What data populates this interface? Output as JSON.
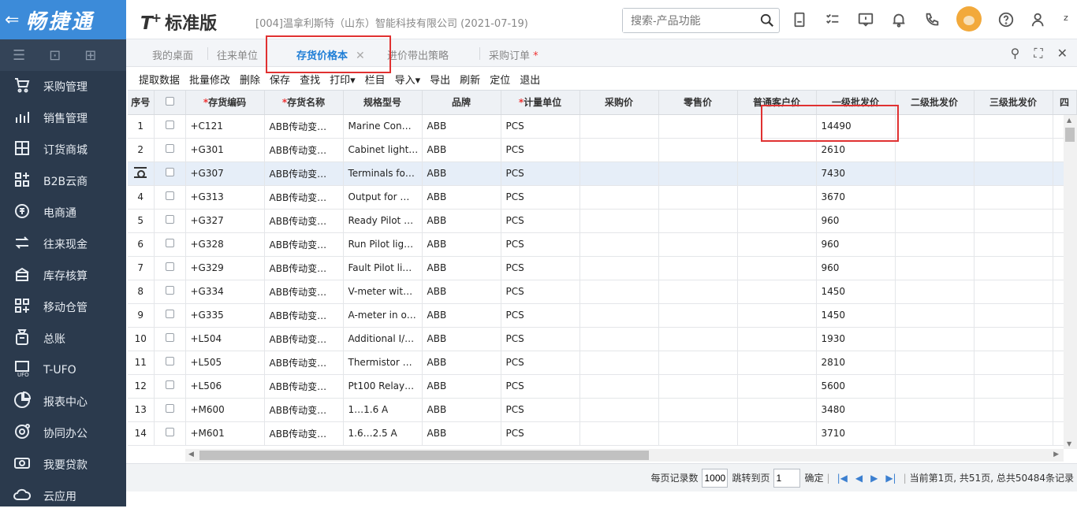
{
  "sidebar": {
    "brand": "畅捷通",
    "items": [
      {
        "label": "采购管理",
        "icon": "cart-icon"
      },
      {
        "label": "销售管理",
        "icon": "chart-icon"
      },
      {
        "label": "订货商城",
        "icon": "store-icon"
      },
      {
        "label": "B2B云商",
        "icon": "grid-plus-icon"
      },
      {
        "label": "电商通",
        "icon": "ecommerce-icon"
      },
      {
        "label": "往来现金",
        "icon": "exchange-icon"
      },
      {
        "label": "库存核算",
        "icon": "inventory-icon"
      },
      {
        "label": "移动仓管",
        "icon": "mobile-warehouse-icon"
      },
      {
        "label": "总账",
        "icon": "ledger-icon"
      },
      {
        "label": "T-UFO",
        "icon": "ufo-icon"
      },
      {
        "label": "报表中心",
        "icon": "pie-icon"
      },
      {
        "label": "协同办公",
        "icon": "collab-icon"
      },
      {
        "label": "我要贷款",
        "icon": "loan-icon"
      },
      {
        "label": "云应用",
        "icon": "cloud-icon"
      }
    ]
  },
  "header": {
    "logo": "T",
    "logo_plus": "+",
    "edition": "标准版",
    "company": "[004]温拿利斯特（山东）智能科技有限公司   (2021-07-19)",
    "search_placeholder": "搜索-产品功能",
    "user": "z"
  },
  "tabs": [
    {
      "label": "我的桌面"
    },
    {
      "label": "往来单位"
    },
    {
      "label": "存货价格本",
      "close": "✕"
    },
    {
      "label": "进价带出策略"
    },
    {
      "label": "采购订单",
      "mark": "*"
    }
  ],
  "toolbar": [
    "提取数据",
    "批量修改",
    "删除",
    "保存",
    "查找",
    "打印▾",
    "栏目",
    "导入▾",
    "导出",
    "刷新",
    "定位",
    "退出"
  ],
  "grid": {
    "columns": [
      "序号",
      "",
      "存货编码",
      "存货名称",
      "规格型号",
      "品牌",
      "计量单位",
      "采购价",
      "零售价",
      "普通客户价",
      "一级批发价",
      "二级批发价",
      "三级批发价",
      "四"
    ],
    "required_mark": "*",
    "rows": [
      {
        "seq": "1",
        "code": "+C121",
        "name": "ABB传动变…",
        "spec": "Marine Con…",
        "brand": "ABB",
        "unit": "PCS",
        "w1": "14490"
      },
      {
        "seq": "2",
        "code": "+G301",
        "name": "ABB传动变…",
        "spec": "Cabinet light…",
        "brand": "ABB",
        "unit": "PCS",
        "w1": "2610"
      },
      {
        "seq": "",
        "code": "+G307",
        "name": "ABB传动变…",
        "spec": "Terminals fo…",
        "brand": "ABB",
        "unit": "PCS",
        "w1": "7430"
      },
      {
        "seq": "4",
        "code": "+G313",
        "name": "ABB传动变…",
        "spec": "Output for …",
        "brand": "ABB",
        "unit": "PCS",
        "w1": "3670"
      },
      {
        "seq": "5",
        "code": "+G327",
        "name": "ABB传动变…",
        "spec": "Ready Pilot …",
        "brand": "ABB",
        "unit": "PCS",
        "w1": "960"
      },
      {
        "seq": "6",
        "code": "+G328",
        "name": "ABB传动变…",
        "spec": "Run Pilot lig…",
        "brand": "ABB",
        "unit": "PCS",
        "w1": "960"
      },
      {
        "seq": "7",
        "code": "+G329",
        "name": "ABB传动变…",
        "spec": "Fault Pilot li…",
        "brand": "ABB",
        "unit": "PCS",
        "w1": "960"
      },
      {
        "seq": "8",
        "code": "+G334",
        "name": "ABB传动变…",
        "spec": "V-meter wit…",
        "brand": "ABB",
        "unit": "PCS",
        "w1": "1450"
      },
      {
        "seq": "9",
        "code": "+G335",
        "name": "ABB传动变…",
        "spec": "A-meter in o…",
        "brand": "ABB",
        "unit": "PCS",
        "w1": "1450"
      },
      {
        "seq": "10",
        "code": "+L504",
        "name": "ABB传动变…",
        "spec": "Additional I/…",
        "brand": "ABB",
        "unit": "PCS",
        "w1": "1930"
      },
      {
        "seq": "11",
        "code": "+L505",
        "name": "ABB传动变…",
        "spec": "Thermistor …",
        "brand": "ABB",
        "unit": "PCS",
        "w1": "2810"
      },
      {
        "seq": "12",
        "code": "+L506",
        "name": "ABB传动变…",
        "spec": "Pt100 Relay…",
        "brand": "ABB",
        "unit": "PCS",
        "w1": "5600"
      },
      {
        "seq": "13",
        "code": "+M600",
        "name": "ABB传动变…",
        "spec": "1…1.6 A",
        "brand": "ABB",
        "unit": "PCS",
        "w1": "3480"
      },
      {
        "seq": "14",
        "code": "+M601",
        "name": "ABB传动变…",
        "spec": "1.6…2.5 A",
        "brand": "ABB",
        "unit": "PCS",
        "w1": "3710"
      }
    ]
  },
  "pager": {
    "per_page_label": "每页记录数",
    "per_page": "1000",
    "jump_label": "跳转到页",
    "jump_value": "1",
    "confirm": "确定",
    "summary": "当前第1页, 共51页, 总共50484条记录"
  },
  "colors": {
    "sidebar": "#2b3a4d",
    "brand": "#3c8bd9",
    "accent": "#1f7ed6",
    "highlight": "#e03131"
  }
}
